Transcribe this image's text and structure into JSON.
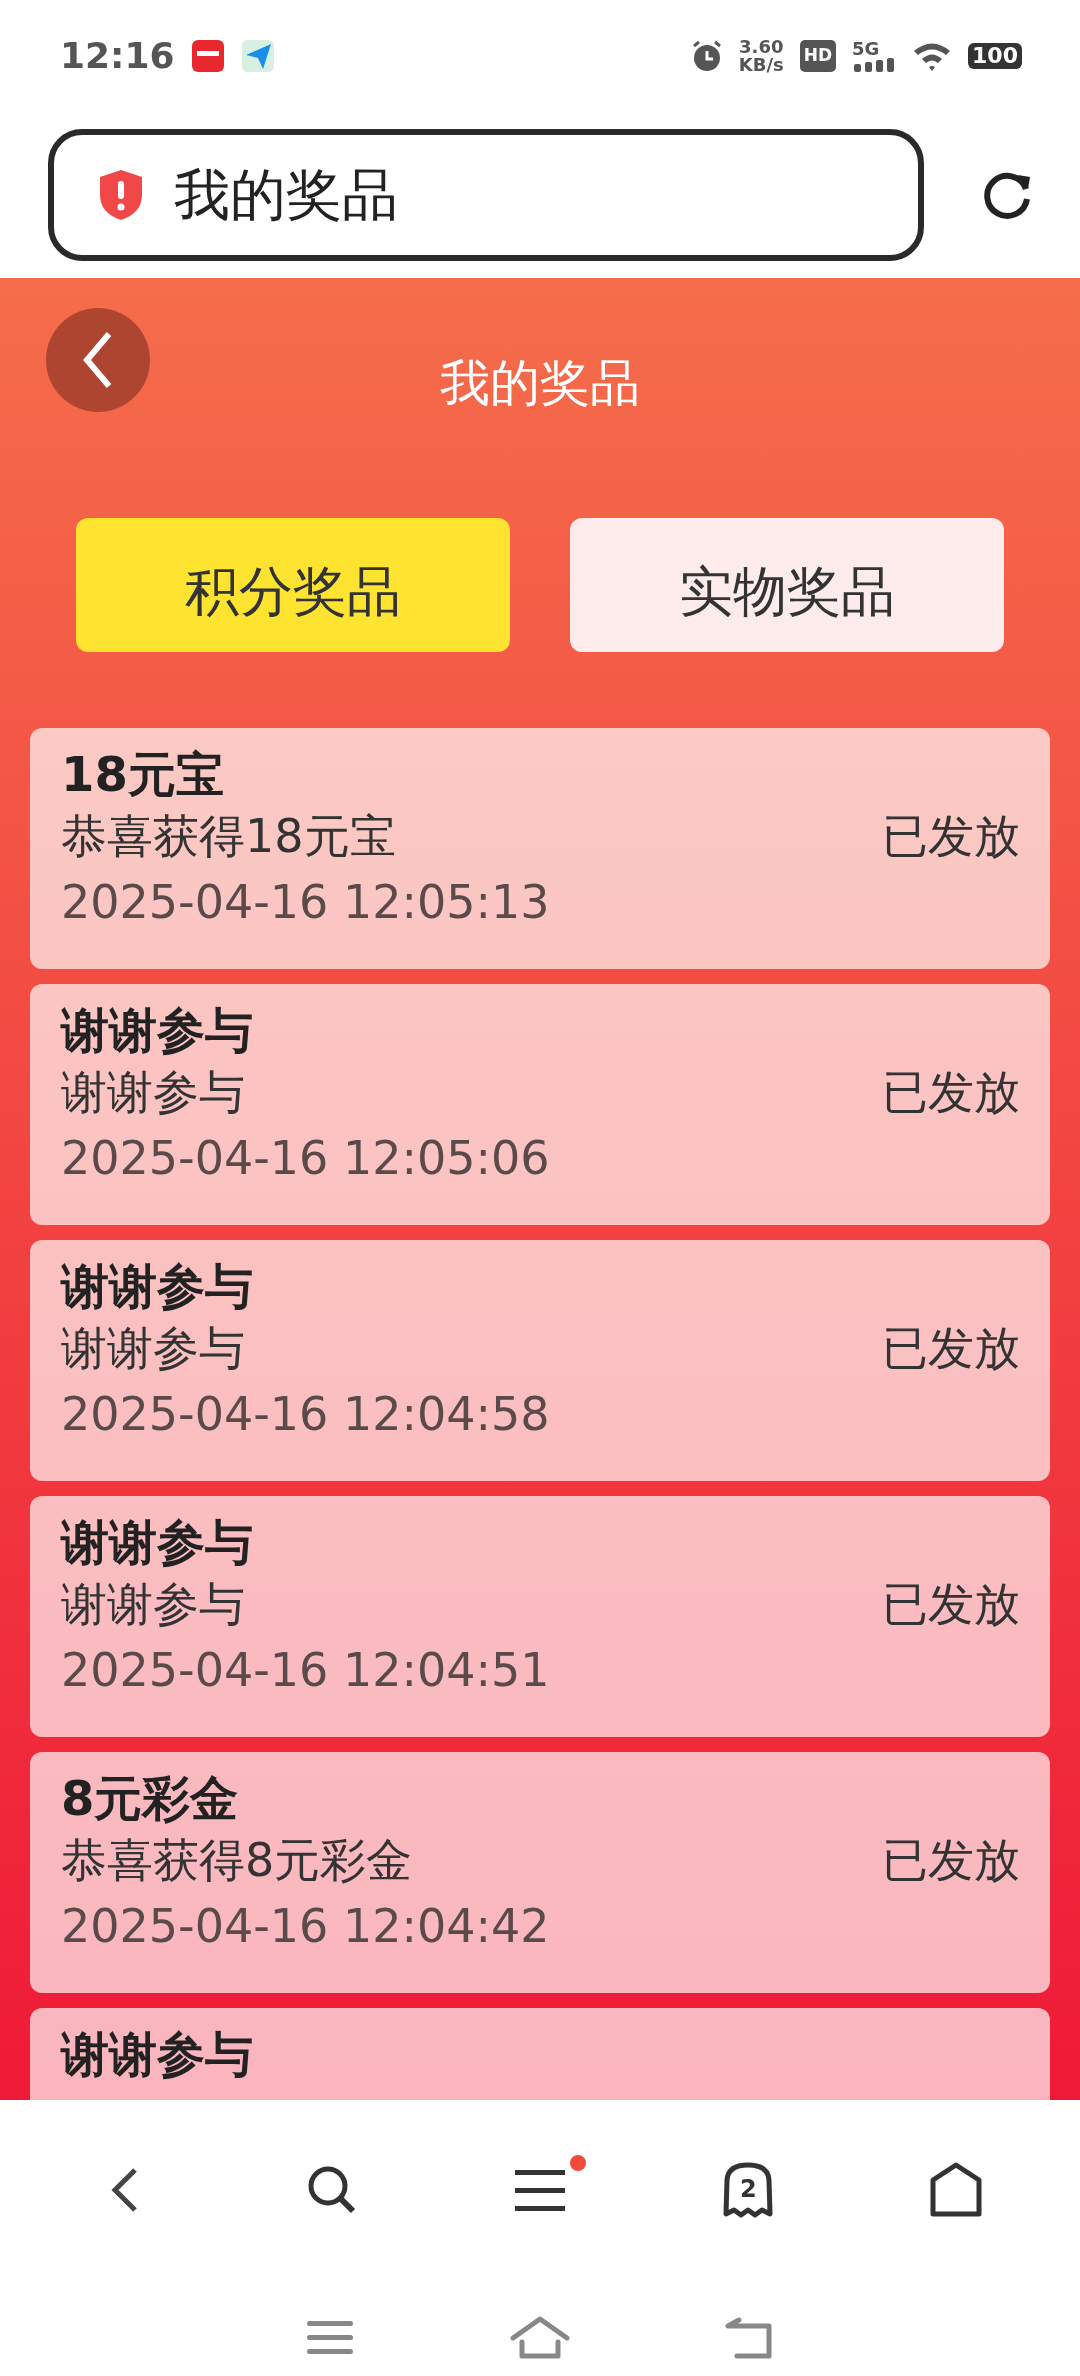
{
  "status_bar": {
    "time": "12:16",
    "net_speed_value": "3.60",
    "net_speed_unit": "KB/s",
    "hd": "HD",
    "network": "5G",
    "battery": "100"
  },
  "address_bar": {
    "title": "我的奖品"
  },
  "header": {
    "title": "我的奖品"
  },
  "tabs": [
    {
      "label": "积分奖品",
      "selected": true
    },
    {
      "label": "实物奖品",
      "selected": false
    }
  ],
  "prizes": [
    {
      "title": "18元宝",
      "description": "恭喜获得18元宝",
      "status": "已发放",
      "time": "2025-04-16 12:05:13"
    },
    {
      "title": "谢谢参与",
      "description": "谢谢参与",
      "status": "已发放",
      "time": "2025-04-16 12:05:06"
    },
    {
      "title": "谢谢参与",
      "description": "谢谢参与",
      "status": "已发放",
      "time": "2025-04-16 12:04:58"
    },
    {
      "title": "谢谢参与",
      "description": "谢谢参与",
      "status": "已发放",
      "time": "2025-04-16 12:04:51"
    },
    {
      "title": "8元彩金",
      "description": "恭喜获得8元彩金",
      "status": "已发放",
      "time": "2025-04-16 12:04:42"
    },
    {
      "title": "谢谢参与"
    }
  ],
  "browser_toolbar": {
    "menu_notification": true,
    "tab_count": "2"
  }
}
